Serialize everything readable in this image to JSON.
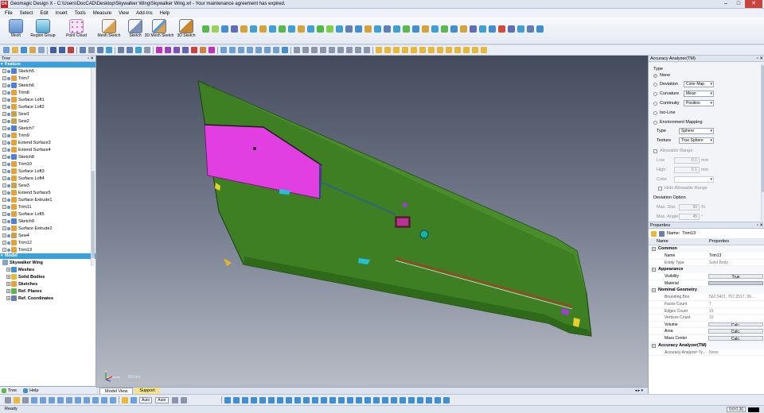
{
  "window": {
    "title": "Geomagic Design X - C:\\Users\\DocCAD\\Desktop\\Skywalker Wing\\Skywalker Wing.xrl - Your maintenance agreement has expired.",
    "logo": "DX"
  },
  "menu": [
    "File",
    "Select",
    "Edit",
    "Insert",
    "Tools",
    "Measure",
    "View",
    "Add-Ins",
    "Help"
  ],
  "ribbon": [
    {
      "label": "Mesh",
      "icon": "mesh-icon"
    },
    {
      "label": "Region Group",
      "icon": "region-group-icon"
    },
    {
      "label": "Point Cloud",
      "icon": "point-cloud-icon"
    },
    {
      "label": "Mesh Sketch",
      "icon": "mesh-sketch-icon"
    },
    {
      "label": "Sketch",
      "icon": "sketch-icon"
    },
    {
      "label": "3D Mesh Sketch",
      "icon": "3d-mesh-sketch-icon"
    },
    {
      "label": "3D Sketch",
      "icon": "3d-sketch-icon"
    }
  ],
  "tree": {
    "panel_title": "Tree",
    "feature_header": "Feature",
    "features": [
      {
        "label": "Sketch5",
        "type": "sketch"
      },
      {
        "label": "Trim7",
        "type": "trim"
      },
      {
        "label": "Sketch6",
        "type": "sketch"
      },
      {
        "label": "Trim8",
        "type": "trim"
      },
      {
        "label": "Surface Loft1",
        "type": "surface"
      },
      {
        "label": "Surface Loft2",
        "type": "surface"
      },
      {
        "label": "Sew1",
        "type": "sew"
      },
      {
        "label": "Sew2",
        "type": "sew"
      },
      {
        "label": "Sketch7",
        "type": "sketch"
      },
      {
        "label": "Trim9",
        "type": "trim"
      },
      {
        "label": "Extend Surface3",
        "type": "surface"
      },
      {
        "label": "Extend Surface4",
        "type": "surface"
      },
      {
        "label": "Sketch8",
        "type": "sketch"
      },
      {
        "label": "Trim10",
        "type": "trim"
      },
      {
        "label": "Surface Loft3",
        "type": "surface"
      },
      {
        "label": "Surface Loft4",
        "type": "surface"
      },
      {
        "label": "Sew3",
        "type": "sew"
      },
      {
        "label": "Extend Surface5",
        "type": "surface"
      },
      {
        "label": "Surface Extrude1",
        "type": "surface"
      },
      {
        "label": "Trim11",
        "type": "trim"
      },
      {
        "label": "Surface Loft5",
        "type": "surface"
      },
      {
        "label": "Sketch9",
        "type": "sketch"
      },
      {
        "label": "Surface Extrude2",
        "type": "surface"
      },
      {
        "label": "Sew4",
        "type": "sew"
      },
      {
        "label": "Trim12",
        "type": "trim"
      },
      {
        "label": "Trim13",
        "type": "trim"
      }
    ],
    "model_header": "Model",
    "model_root": "Skywalker Wing",
    "model_items": [
      "Meshes",
      "Solid Bodies",
      "Sketches",
      "Ref. Planes",
      "Ref. Coordinates"
    ],
    "tabs": [
      "Tree",
      "Help"
    ]
  },
  "viewport": {
    "scale_label": "50 mm",
    "tabs": [
      "Model View",
      "Support"
    ]
  },
  "accuracy": {
    "title": "Accuracy Analyzer(TM)",
    "type_label": "Type",
    "options": [
      "None",
      "Deviation",
      "Curvature",
      "Continuity",
      "Iso-Line",
      "Environment Mapping"
    ],
    "selected": "None",
    "deviation_value": "Color Map",
    "curvature_value": "Mean",
    "continuity_value": "Position",
    "env_type_label": "Type",
    "env_type_value": "Sphere",
    "texture_label": "Texture",
    "texture_value": "True Sphere",
    "allowable_range": "Allowable Range",
    "low_label": "Low",
    "low_value": "-0.1",
    "high_label": "High",
    "high_value": "0.1",
    "unit": "mm",
    "color_label": "Color",
    "hide_label": "Hide Allowable Range",
    "deviation_option": "Deviation Option",
    "max_dist_label": "Max. Dist.",
    "max_dist_value": "50",
    "max_dist_unit": "%",
    "max_angle_label": "Max. Angle",
    "max_angle_value": "45",
    "max_angle_unit": "°"
  },
  "properties": {
    "title": "Properties",
    "name_label": "Name:",
    "name_value": "Trim13",
    "col_name": "Name",
    "col_props": "Properties",
    "sections": [
      {
        "title": "Common",
        "rows": [
          {
            "name": "Name",
            "value": "Trim13",
            "kind": "text"
          },
          {
            "name": "Entity Type",
            "value": "Solid Body",
            "kind": "dim"
          }
        ]
      },
      {
        "title": "Appearance",
        "rows": [
          {
            "name": "Visibility",
            "value": "True",
            "kind": "button"
          },
          {
            "name": "Material",
            "value": "",
            "kind": "swatch"
          }
        ]
      },
      {
        "title": "Nominal Geometry",
        "rows": [
          {
            "name": "Bounding Box",
            "value": "562.5421, 707.2517, 39...",
            "kind": "dim"
          },
          {
            "name": "Faces Count",
            "value": "7",
            "kind": "dim"
          },
          {
            "name": "Edges Count",
            "value": "15",
            "kind": "dim"
          },
          {
            "name": "Vertices Count",
            "value": "10",
            "kind": "dim"
          },
          {
            "name": "Volume",
            "value": "Calc.",
            "kind": "button"
          },
          {
            "name": "Area",
            "value": "Calc.",
            "kind": "button"
          },
          {
            "name": "Mass Center",
            "value": "Calc.",
            "kind": "button"
          }
        ]
      },
      {
        "title": "Accuracy Analyzer(TM)",
        "rows": [
          {
            "name": "Accuracy Analyzer Ty...",
            "value": "None",
            "kind": "dim"
          }
        ]
      }
    ]
  },
  "bottombar": {
    "combo1": "Auto",
    "combo2": "Auto"
  },
  "status": {
    "text": "Ready",
    "time": "0:0:0.36"
  }
}
